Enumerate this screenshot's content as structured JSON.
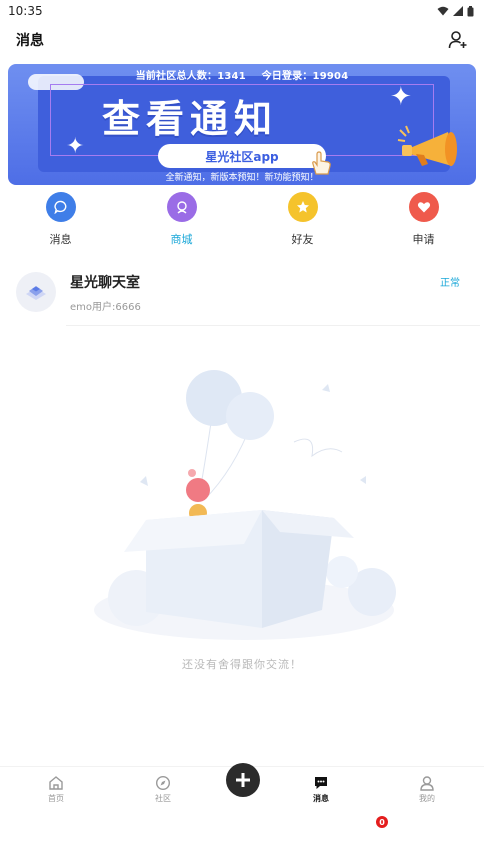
{
  "status_bar": {
    "time": "10:35"
  },
  "header": {
    "title": "消息",
    "add_icon": "person-add-icon"
  },
  "banner": {
    "stats_total_label": "当前社区总人数：1341",
    "stats_today_label": "今日登录：19904",
    "title": "查看通知",
    "app_name": "星光社区app",
    "subtitle": "全新通知，新版本预知！新功能预知！"
  },
  "quick_nav": [
    {
      "label": "消息",
      "icon": "chat-bubble-icon",
      "color": "#3f7ee8",
      "active": false
    },
    {
      "label": "商城",
      "icon": "store-icon",
      "color": "#9a6ce6",
      "active": true
    },
    {
      "label": "好友",
      "icon": "star-icon",
      "color": "#f5c32c",
      "active": false
    },
    {
      "label": "申请",
      "icon": "heart-icon",
      "color": "#ef5a4c",
      "active": false
    }
  ],
  "chat": {
    "name": "星光聊天室",
    "preview": "emo用户:6666",
    "status": "正常"
  },
  "empty_state": {
    "text": "还没有舍得跟你交流！"
  },
  "tab_bar": {
    "items": [
      {
        "label": "首页",
        "icon": "home-icon"
      },
      {
        "label": "社区",
        "icon": "compass-icon"
      },
      {
        "label": "消息",
        "icon": "message-icon"
      },
      {
        "label": "我的",
        "icon": "profile-icon"
      }
    ],
    "publish_icon": "plus-icon",
    "unread_count": "0"
  },
  "colors": {
    "accent": "#1aa7d8",
    "banner_bg": "#4e6ee6",
    "badge": "#e41d1d"
  }
}
